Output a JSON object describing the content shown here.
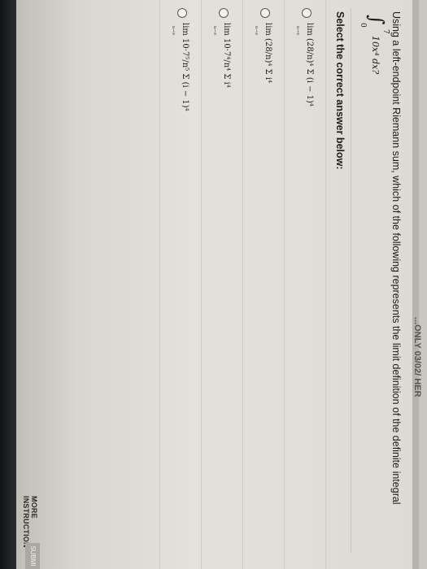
{
  "header": {
    "nav_text": "...ONLY 03/02/ HER"
  },
  "question": {
    "text": "Using a left-endpoint Riemann sum, which of the following represents the limit definition of the definite integral",
    "integral_upper": "7",
    "integral_lower": "0",
    "integrand": "10x⁴ dx?"
  },
  "prompt": "Select the correct answer below:",
  "answers": [
    {
      "formula": "lim (28/n)⁴ Σ (i − 1)⁴",
      "limit_sub": "n→∞",
      "sum_sub": "i=1"
    },
    {
      "formula": "lim (28/n)⁴ Σ i⁴",
      "limit_sub": "n→∞",
      "sum_sub": "i=1"
    },
    {
      "formula": "lim 10·7⁴/n⁴ Σ i⁴",
      "limit_sub": "n→∞",
      "sum_sub": "i=1"
    },
    {
      "formula": "lim 10·7⁵/n⁵ Σ (i − 1)⁴",
      "limit_sub": "n→∞",
      "sum_sub": "i=1"
    }
  ],
  "footer": {
    "more_instructions": "MORE INSTRUCTION",
    "submit": "SUBMI"
  }
}
